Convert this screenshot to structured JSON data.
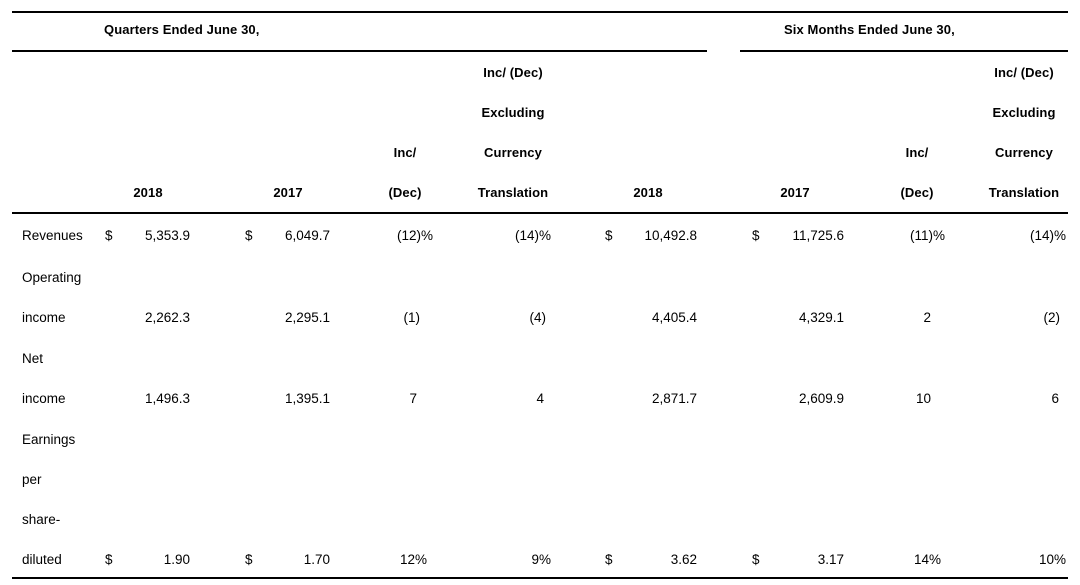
{
  "document": {
    "type": "financial-results-table",
    "currency_symbol": "$"
  },
  "group_headers": [
    {
      "label": "Quarters Ended June 30,"
    },
    {
      "label": "Six Months Ended June 30,"
    }
  ],
  "column_header_lines": {
    "inc_dec_line1": "Inc/",
    "inc_dec_line2": "(Dec)",
    "excl_fx_line1": "Inc/ (Dec)",
    "excl_fx_line2": "Excluding",
    "excl_fx_line3": "Currency",
    "excl_fx_line4": "Translation",
    "year_2018": "2018",
    "year_2017": "2017"
  },
  "columns": [
    {
      "key": "q_2018",
      "label": "2018",
      "group": "Quarters Ended June 30,"
    },
    {
      "key": "q_2017",
      "label": "2017",
      "group": "Quarters Ended June 30,"
    },
    {
      "key": "q_incdec",
      "label": "Inc/ (Dec)",
      "group": "Quarters Ended June 30,"
    },
    {
      "key": "q_exfx",
      "label": "Inc/ (Dec) Excluding Currency Translation",
      "group": "Quarters Ended June 30,"
    },
    {
      "key": "s_2018",
      "label": "2018",
      "group": "Six Months Ended June 30,"
    },
    {
      "key": "s_2017",
      "label": "2017",
      "group": "Six Months Ended June 30,"
    },
    {
      "key": "s_incdec",
      "label": "Inc/ (Dec)",
      "group": "Six Months Ended June 30,"
    },
    {
      "key": "s_exfx",
      "label": "Inc/ (Dec) Excluding Currency Translation",
      "group": "Six Months Ended June 30,"
    }
  ],
  "rows": [
    {
      "label_lines": [
        "Revenues"
      ],
      "q_2018_sym": "$",
      "q_2018": "5,353.9",
      "q_2017_sym": "$",
      "q_2017": "6,049.7",
      "q_incdec": "(12)%",
      "q_exfx": "(14)%",
      "s_2018_sym": "$",
      "s_2018": "10,492.8",
      "s_2017_sym": "$",
      "s_2017": "11,725.6",
      "s_incdec": "(11)%",
      "s_exfx": "(14)%"
    },
    {
      "label_lines": [
        "Operating",
        "income"
      ],
      "q_2018_sym": "",
      "q_2018": "2,262.3",
      "q_2017_sym": "",
      "q_2017": "2,295.1",
      "q_incdec": "(1)",
      "q_exfx": "(4)",
      "s_2018_sym": "",
      "s_2018": "4,405.4",
      "s_2017_sym": "",
      "s_2017": "4,329.1",
      "s_incdec": "2",
      "s_exfx": "(2)"
    },
    {
      "label_lines": [
        "Net",
        "income"
      ],
      "q_2018_sym": "",
      "q_2018": "1,496.3",
      "q_2017_sym": "",
      "q_2017": "1,395.1",
      "q_incdec": "7",
      "q_exfx": "4",
      "s_2018_sym": "",
      "s_2018": "2,871.7",
      "s_2017_sym": "",
      "s_2017": "2,609.9",
      "s_incdec": "10",
      "s_exfx": "6"
    },
    {
      "label_lines": [
        "Earnings",
        "per",
        "share-",
        "diluted"
      ],
      "q_2018_sym": "$",
      "q_2018": "1.90",
      "q_2017_sym": "$",
      "q_2017": "1.70",
      "q_incdec": "12%",
      "q_exfx": "9%",
      "s_2018_sym": "$",
      "s_2018": "3.62",
      "s_2017_sym": "$",
      "s_2017": "3.17",
      "s_incdec": "14%",
      "s_exfx": "10%"
    }
  ],
  "chart_data": {
    "type": "table",
    "title": "",
    "categories": [
      "Revenues",
      "Operating income",
      "Net income",
      "Earnings per share- diluted"
    ],
    "columns": [
      "Quarters Ended June 30, 2018",
      "Quarters Ended June 30, 2017",
      "Quarters Inc/ (Dec)",
      "Quarters Inc/ (Dec) Excluding Currency Translation",
      "Six Months Ended June 30, 2018",
      "Six Months Ended June 30, 2017",
      "Six Months Inc/ (Dec)",
      "Six Months Inc/ (Dec) Excluding Currency Translation"
    ],
    "series": [
      {
        "name": "Revenues",
        "values": [
          "5,353.9",
          "6,049.7",
          "(12)%",
          "(14)%",
          "10,492.8",
          "11,725.6",
          "(11)%",
          "(14)%"
        ]
      },
      {
        "name": "Operating income",
        "values": [
          "2,262.3",
          "2,295.1",
          "(1)",
          "(4)",
          "4,405.4",
          "4,329.1",
          "2",
          "(2)"
        ]
      },
      {
        "name": "Net income",
        "values": [
          "1,496.3",
          "1,395.1",
          "7",
          "4",
          "2,871.7",
          "2,609.9",
          "10",
          "6"
        ]
      },
      {
        "name": "Earnings per share- diluted",
        "values": [
          "1.90",
          "1.70",
          "12%",
          "9%",
          "3.62",
          "3.17",
          "14%",
          "10%"
        ]
      }
    ]
  }
}
